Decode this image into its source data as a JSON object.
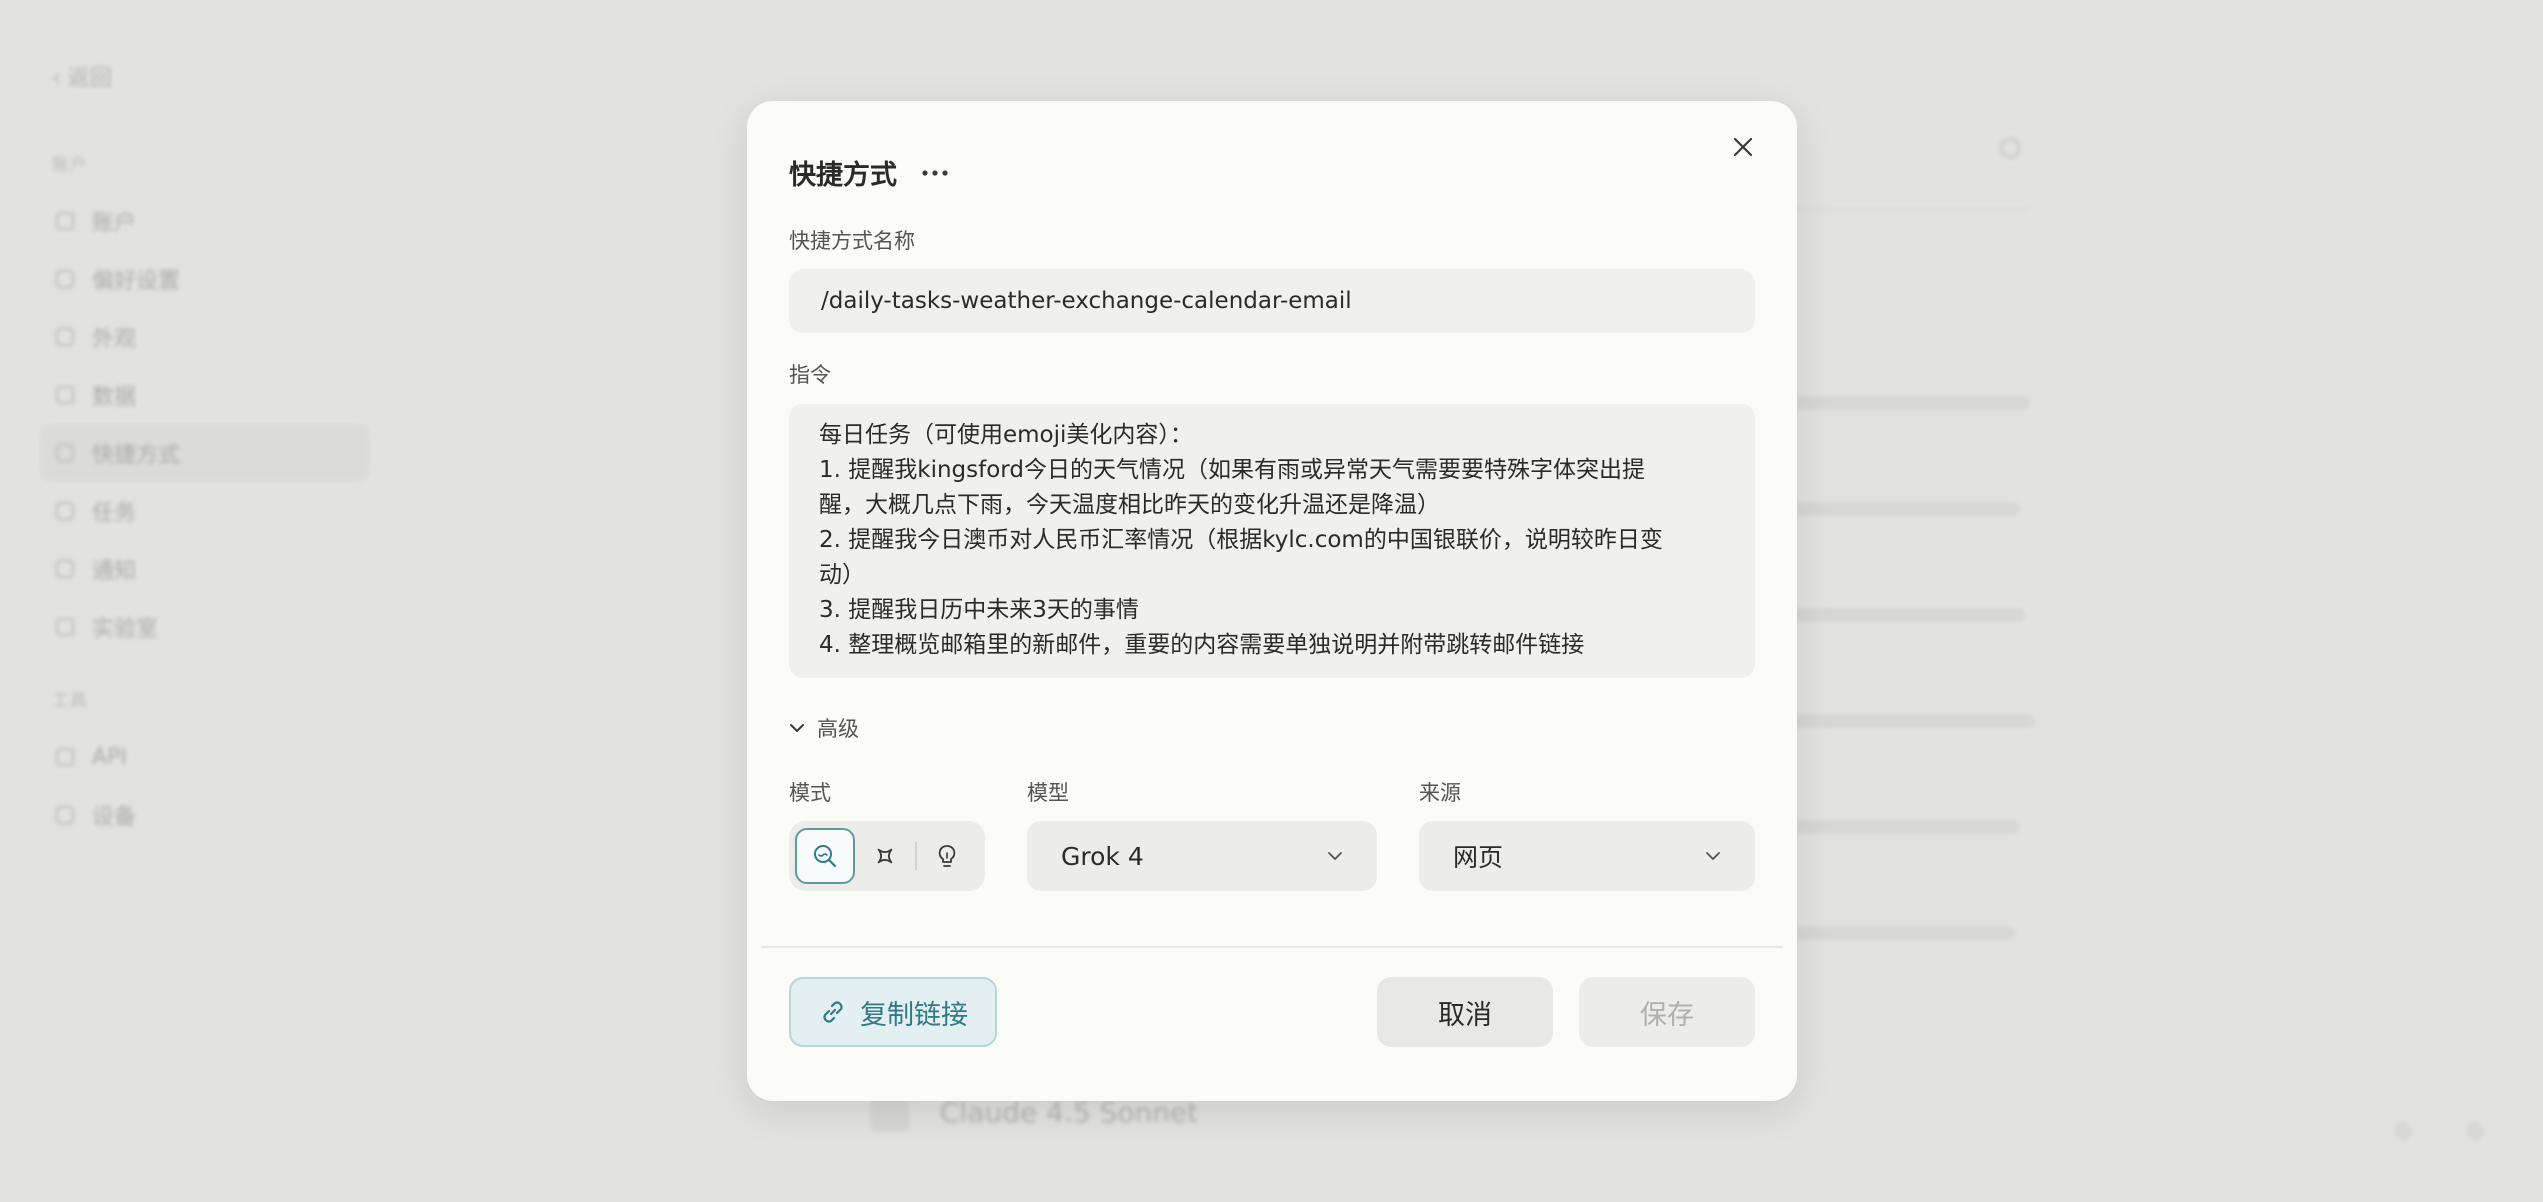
{
  "background": {
    "back_label": "返回",
    "section_one": "账户",
    "section_two": "工具",
    "nav_items": [
      {
        "label": "账户"
      },
      {
        "label": "偏好设置"
      },
      {
        "label": "外观"
      },
      {
        "label": "数据"
      },
      {
        "label": "快捷方式",
        "active": true
      },
      {
        "label": "任务"
      },
      {
        "label": "通知"
      },
      {
        "label": "实验室"
      }
    ],
    "nav_items_two": [
      {
        "label": "API"
      },
      {
        "label": "设备"
      }
    ],
    "bottom_title": "Claude 4.5 Sonnet"
  },
  "dialog": {
    "title": "快捷方式",
    "name_label": "快捷方式名称",
    "name_value": "/daily-tasks-weather-exchange-calendar-email",
    "instruction_label": "指令",
    "instruction_lines": [
      "每日任务（可使用emoji美化内容）：",
      "1. 提醒我kingsford今日的天气情况（如果有雨或异常天气需要要特殊字体突出提",
      "醒，大概几点下雨，今天温度相比昨天的变化升温还是降温）",
      "2. 提醒我今日澳币对人民币汇率情况（根据kylc.com的中国银联价，说明较昨日变",
      "动）",
      "3. 提醒我日历中未来3天的事情",
      "4. 整理概览邮箱里的新邮件，重要的内容需要单独说明并附带跳转邮件链接"
    ],
    "advanced_label": "高级",
    "mode_label": "模式",
    "mode_options": [
      "search-icon",
      "sparkle-icon",
      "lightbulb-icon"
    ],
    "mode_selected": 0,
    "model_label": "模型",
    "model_value": "Grok 4",
    "source_label": "来源",
    "source_value": "网页",
    "copy_link_label": "复制链接",
    "cancel_label": "取消",
    "save_label": "保存"
  },
  "colors": {
    "accent": "#2f7a86",
    "accent_bg": "#e3eff0",
    "dialog_bg": "#fbfbf8",
    "field_bg": "#f0f0ed"
  }
}
